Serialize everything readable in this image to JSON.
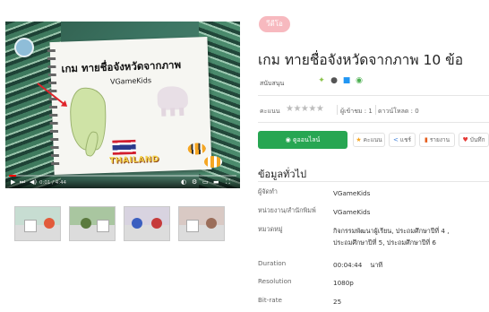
{
  "video": {
    "game_title": "เกม ทายชื่อจังหวัดจากภาพ",
    "brand": "VGameKids",
    "banner": "THAILAND",
    "progress": 0.03,
    "time": "0:01 / 4:44"
  },
  "header": {
    "badge": "วีดีโอ",
    "title": "เกม ทายชื่อจังหวัดจากภาพ 10 ข้อ"
  },
  "support": {
    "label": "สนับสนุน",
    "platforms": [
      {
        "name": "android-icon",
        "glyph": "✦",
        "color": "#8bc34a"
      },
      {
        "name": "apple-icon",
        "glyph": "●",
        "color": "#555555"
      },
      {
        "name": "windows-icon",
        "glyph": "■",
        "color": "#2196f3"
      },
      {
        "name": "web-icon",
        "glyph": "◉",
        "color": "#4caf50"
      }
    ]
  },
  "rating": {
    "label": "คะแนน",
    "stars": "★★★★★",
    "voters": "ผู้เข้าชม : 1",
    "downloads": "ดาวน์โหลด : 0"
  },
  "actions": {
    "primary": "◉ ดูออนไลน์",
    "rate": "คะแนน",
    "share": "แชร์",
    "report": "รายงาน",
    "favorite": "บันทึก"
  },
  "info": {
    "section_title": "ข้อมูลทั่วไป",
    "rows": [
      {
        "key": "ผู้จัดทำ",
        "value": "VGameKids"
      },
      {
        "key": "หน่วยงาน/สำนักพิมพ์",
        "value": "VGameKids"
      },
      {
        "key": "หมวดหมู่",
        "value": "กิจกรรมพัฒนาผู้เรียน, ประถมศึกษาปีที่ 4 , ประถมศึกษาปีที่ 5, ประถมศึกษาปีที่ 6"
      },
      {
        "key": "Duration",
        "value": "00:04:44    นาที"
      },
      {
        "key": "Resolution",
        "value": "1080p"
      },
      {
        "key": "Bit-rate",
        "value": "25"
      }
    ]
  },
  "colors": {
    "accent_green": "#27a652",
    "badge_pink": "#f7b9bf"
  }
}
